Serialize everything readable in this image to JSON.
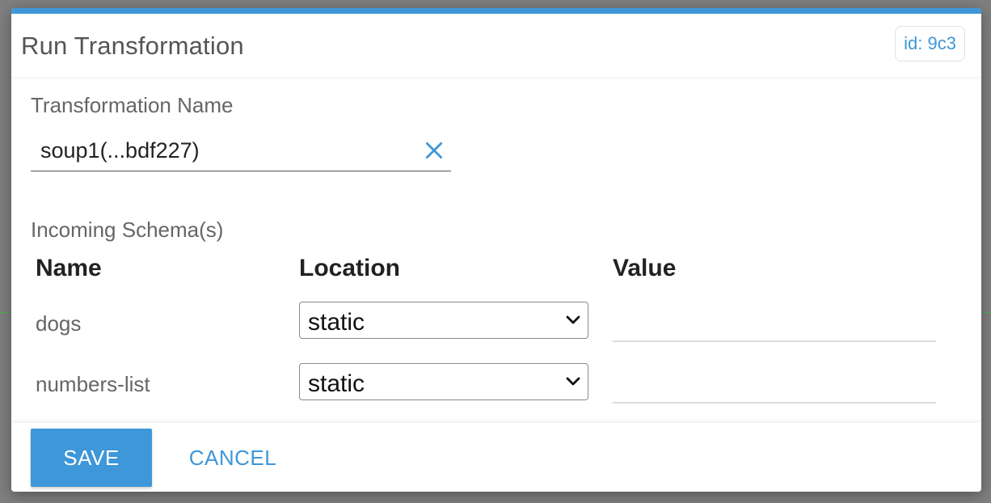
{
  "dialog": {
    "title": "Run Transformation",
    "id_badge": "id: 9c3"
  },
  "form": {
    "name_label": "Transformation Name",
    "name_value": "soup1(...bdf227)",
    "schemas_label": "Incoming Schema(s)",
    "columns": {
      "name": "Name",
      "location": "Location",
      "value": "Value"
    },
    "rows": [
      {
        "name": "dogs",
        "location": "static",
        "value": ""
      },
      {
        "name": "numbers-list",
        "location": "static",
        "value": ""
      }
    ]
  },
  "footer": {
    "save_label": "SAVE",
    "cancel_label": "CANCEL"
  },
  "colors": {
    "accent": "#3d97d8",
    "text_muted": "#666666",
    "text_strong": "#222222"
  },
  "icons": {
    "clear": "close-icon",
    "dropdown": "chevron-down-icon"
  }
}
